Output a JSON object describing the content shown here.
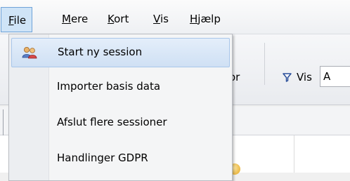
{
  "menubar": {
    "items": [
      {
        "label": "File",
        "underline": "F",
        "rest": "ile"
      },
      {
        "label": "Mere",
        "underline": "M",
        "rest": "ere"
      },
      {
        "label": "Kort",
        "underline": "K",
        "rest": "ort"
      },
      {
        "label": "Vis",
        "underline": "V",
        "rest": "is"
      },
      {
        "label": "Hjælp",
        "underline": "H",
        "rest": "jælp"
      }
    ]
  },
  "dropdown": {
    "items": [
      {
        "label": "Start ny session",
        "icon": "users-icon"
      },
      {
        "label": "Importer basis data"
      },
      {
        "label": "Afslut flere sessioner"
      },
      {
        "label": "Handlinger GDPR"
      }
    ]
  },
  "toolbar": {
    "partial_label": "or",
    "vis_label": "Vis",
    "vis_value": "A",
    "filter_icon": "filter-icon"
  },
  "colors": {
    "highlight": "#cfe4f7",
    "filter": "#2a4f9a"
  }
}
